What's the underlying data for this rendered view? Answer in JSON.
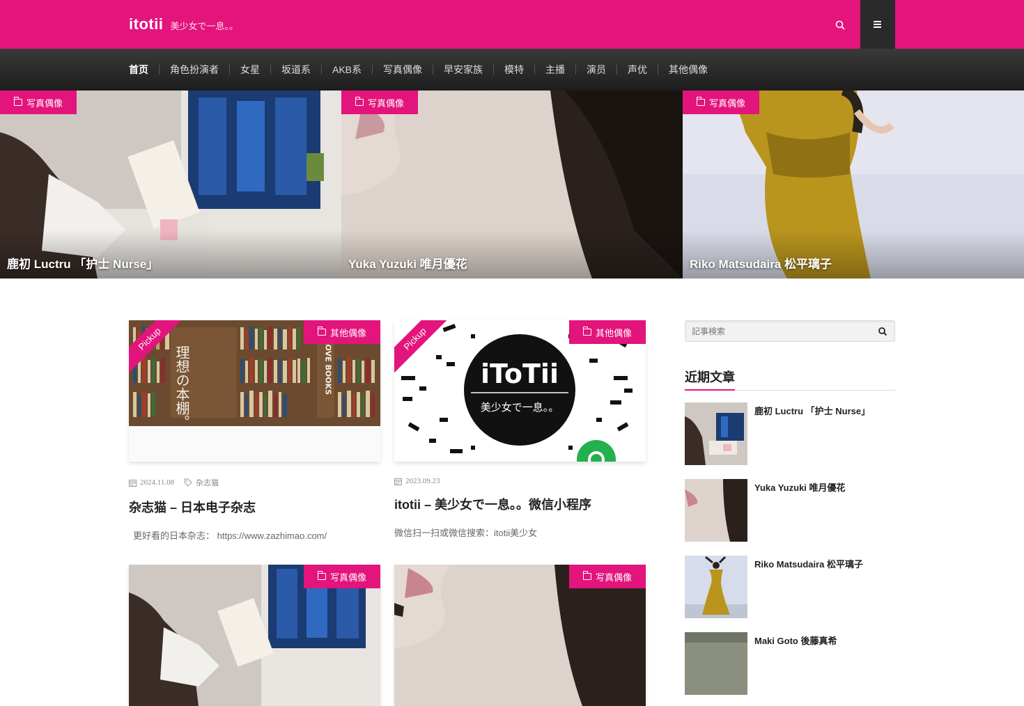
{
  "header": {
    "logo": "itotii",
    "tagline": "美少女で一息。。",
    "search_icon": "search-icon",
    "menu_icon": "menu-icon",
    "accent": "#e3147c"
  },
  "nav": {
    "items": [
      "首页",
      "角色扮演者",
      "女星",
      "坂道系",
      "AKB系",
      "写真偶像",
      "早安家族",
      "模特",
      "主播",
      "演员",
      "声优",
      "其他偶像"
    ]
  },
  "hero": [
    {
      "category": "写真偶像",
      "title": "鹿初 Luctru 「护士 Nurse」"
    },
    {
      "category": "写真偶像",
      "title": "Yuka Yuzuki 唯月優花"
    },
    {
      "category": "写真偶像",
      "title": "Riko Matsudaira 松平璃子"
    }
  ],
  "posts": [
    {
      "ribbon": "Pickup",
      "category": "其他偶像",
      "date": "2024.11.08",
      "tag": "杂志猫",
      "title": "杂志猫 – 日本电子杂志",
      "excerpt": "更好看的日本杂志： https://www.zazhimao.com/",
      "image_text": "理想の本棚。",
      "image_side_text": "I LOVE BOOKS"
    },
    {
      "ribbon": "Pickup",
      "category": "其他偶像",
      "date": "2023.09.23",
      "tag": "",
      "title": "itotii – 美少女で一息。。微信小程序",
      "excerpt": "微信扫一扫或微信搜索：itotii美少女",
      "image_text": "iToTii",
      "image_sub_text": "美少女で一息。。"
    },
    {
      "category": "写真偶像"
    },
    {
      "category": "写真偶像"
    }
  ],
  "sidebar": {
    "search_placeholder": "記事検索",
    "widget_title": "近期文章",
    "recent": [
      {
        "title": "鹿初 Luctru 「护士 Nurse」"
      },
      {
        "title": "Yuka Yuzuki 唯月優花"
      },
      {
        "title": "Riko Matsudaira 松平璃子"
      },
      {
        "title": "Maki Goto 後藤真希"
      }
    ]
  }
}
